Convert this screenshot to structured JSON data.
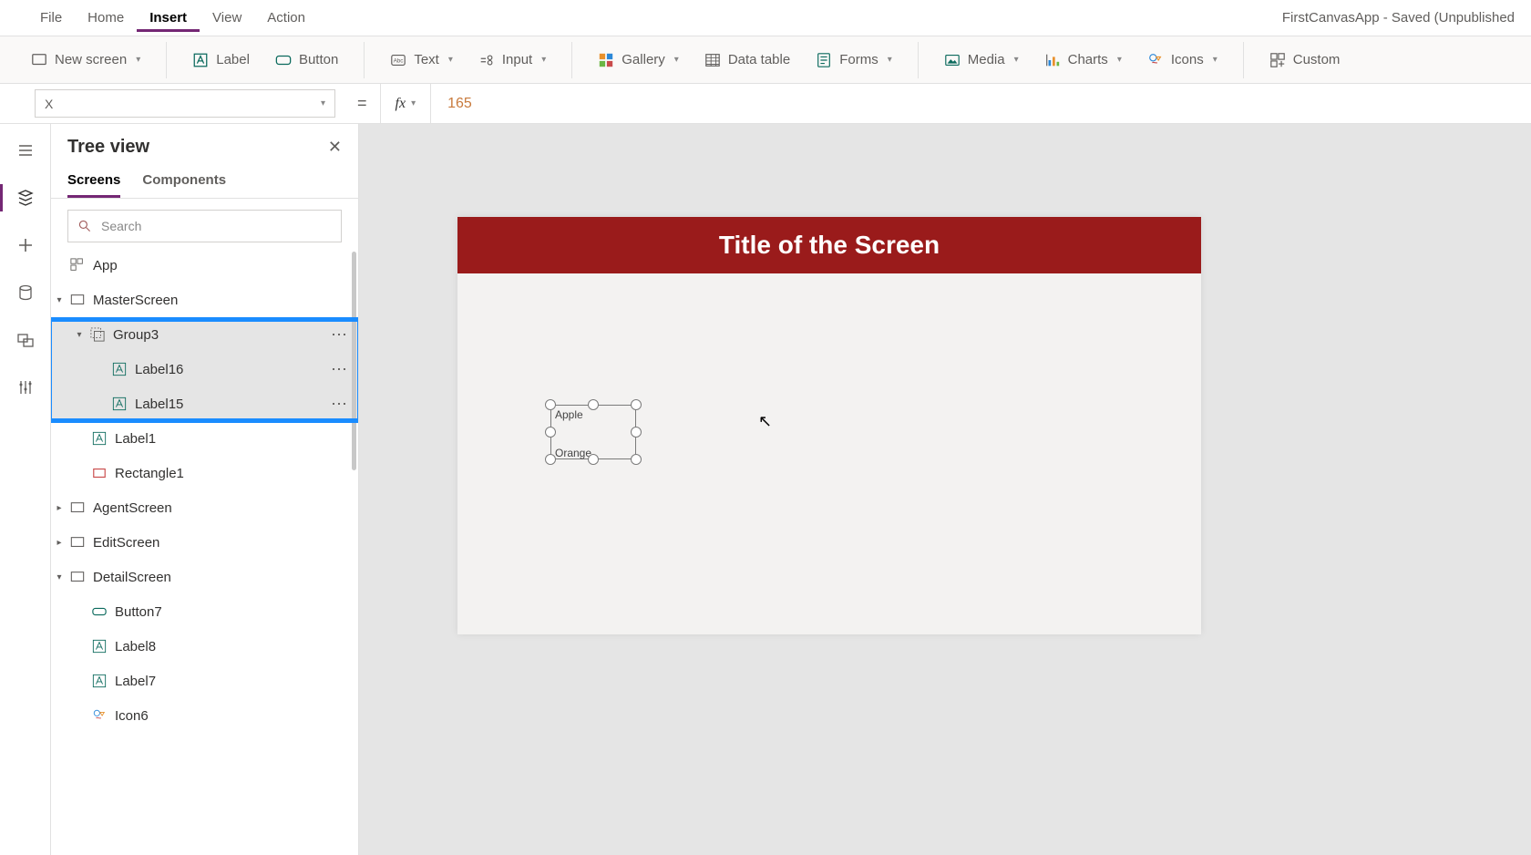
{
  "doc_title": "FirstCanvasApp - Saved (Unpublished",
  "menu": {
    "items": [
      "File",
      "Home",
      "Insert",
      "View",
      "Action"
    ],
    "active": 2
  },
  "ribbon": {
    "new_screen": "New screen",
    "label": "Label",
    "button": "Button",
    "text": "Text",
    "input": "Input",
    "gallery": "Gallery",
    "data_table": "Data table",
    "forms": "Forms",
    "media": "Media",
    "charts": "Charts",
    "icons": "Icons",
    "custom": "Custom"
  },
  "formula": {
    "property": "X",
    "value": "165"
  },
  "tree": {
    "title": "Tree view",
    "tabs": [
      "Screens",
      "Components"
    ],
    "active_tab": 0,
    "search_placeholder": "Search",
    "nodes": {
      "app": "App",
      "master": "MasterScreen",
      "group3": "Group3",
      "label16": "Label16",
      "label15": "Label15",
      "label1": "Label1",
      "rectangle1": "Rectangle1",
      "agent": "AgentScreen",
      "edit": "EditScreen",
      "detail": "DetailScreen",
      "button7": "Button7",
      "label8": "Label8",
      "label7": "Label7",
      "icon6": "Icon6"
    }
  },
  "canvas": {
    "title_text": "Title of the Screen",
    "title_bg": "#9a1b1b",
    "group_items": [
      "Apple",
      "Orange"
    ]
  }
}
